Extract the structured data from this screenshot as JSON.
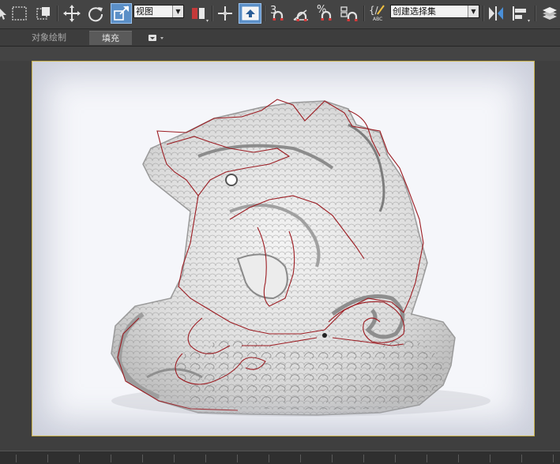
{
  "toolbar": {
    "view_dropdown": "视图",
    "selection_set_dropdown": "创建选择集",
    "snap_3_label": "3",
    "percent_label": "%",
    "edit_named_sel_label": "{/",
    "abc_label": "ABC"
  },
  "ribbon": {
    "tab_object_paint": "对象绘制",
    "tab_fill": "填充"
  },
  "colors": {
    "ui_background": "#444444",
    "active_tool": "#5b8fc7",
    "viewport_border": "#c9b24a",
    "spline_outline": "#9c1c22"
  }
}
